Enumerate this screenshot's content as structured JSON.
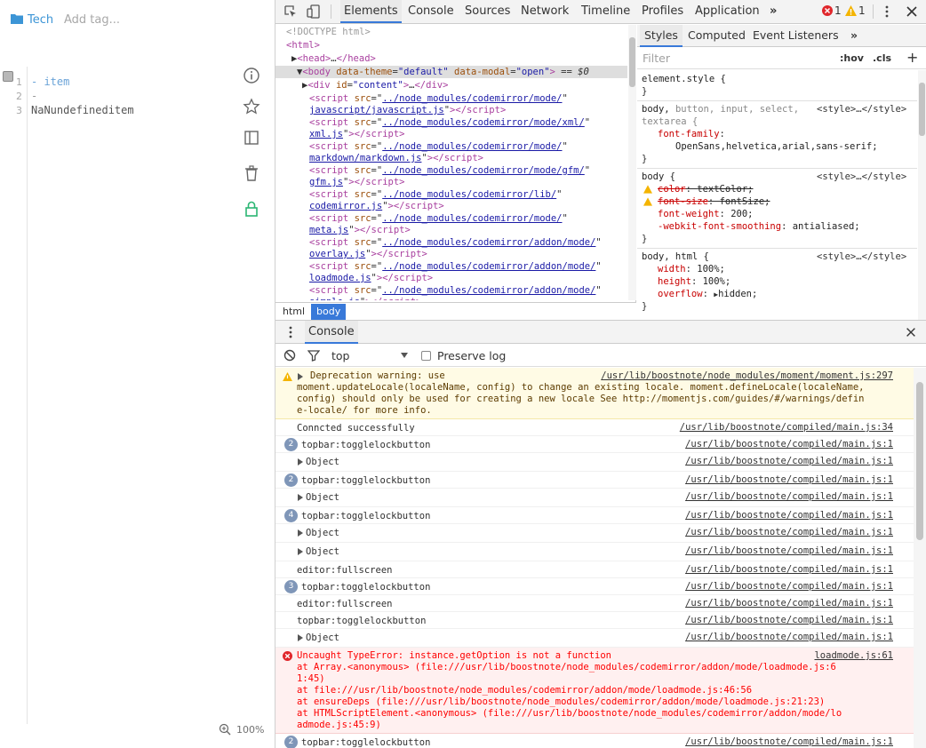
{
  "app": {
    "folder_tag": "Tech",
    "add_tag_placeholder": "Add tag...",
    "editor_lines": [
      "- item",
      "-",
      "NaNundefineditem"
    ],
    "line_numbers": [
      "1",
      "2",
      "3"
    ],
    "zoom": "100%",
    "icons": [
      "info-icon",
      "star-icon",
      "sidebar-icon",
      "trash-icon",
      "lock-icon"
    ]
  },
  "devtools": {
    "tabs": [
      "Elements",
      "Console",
      "Sources",
      "Network",
      "Timeline",
      "Profiles",
      "Application"
    ],
    "error_count": "1",
    "warning_count": "1",
    "dom_lines": [
      {
        "html": "<span class='cm'>&lt;!DOCTYPE html&gt;</span>"
      },
      {
        "html": "<span class='t'>&lt;html&gt;</span>"
      },
      {
        "html": "▶<span class='t'>&lt;head&gt;</span>…<span class='t'>&lt;/head&gt;</span>"
      },
      {
        "html": "▼<span class='t'>&lt;body </span><span class='an'>data-theme</span>=<span class='av'>\"default\"</span> <span class='an'>data-modal</span>=<span class='av'>\"open\"</span><span class='t'>&gt;</span> == <i>$0</i>"
      },
      {
        "html": "▶<span class='t'>&lt;div </span><span class='an'>id</span>=<span class='av'>\"content\"</span><span class='t'>&gt;</span>…<span class='t'>&lt;/div&gt;</span>"
      }
    ],
    "scripts": [
      [
        "../node_modules/codemirror/mode/",
        "javascript/javascript.js"
      ],
      [
        "../node_modules/codemirror/mode/xml/",
        "xml.js"
      ],
      [
        "../node_modules/codemirror/mode/",
        "markdown/markdown.js"
      ],
      [
        "../node_modules/codemirror/mode/gfm/",
        "gfm.js"
      ],
      [
        "../node_modules/codemirror/lib/",
        "codemirror.js"
      ],
      [
        "../node_modules/codemirror/mode/",
        "meta.js"
      ],
      [
        "../node_modules/codemirror/addon/mode/",
        "overlay.js"
      ],
      [
        "../node_modules/codemirror/addon/mode/",
        "loadmode.js"
      ],
      [
        "../node_modules/codemirror/addon/mode/",
        "simple.js"
      ]
    ],
    "breadcrumbs": [
      "html",
      "body"
    ],
    "styles_tabs": [
      "Styles",
      "Computed",
      "Event Listeners"
    ],
    "filter_placeholder": "Filter",
    "hov": ":hov",
    "cls": ".cls",
    "style_rules": [
      {
        "selector": "element.style {",
        "source": "",
        "props": [],
        "close": "}"
      },
      {
        "selector": "body, button, input, select,",
        "selector2": "textarea {",
        "source": "<style>…</style>",
        "props": [
          {
            "name": "font-family",
            "value": "",
            "value2": "OpenSans,helvetica,arial,sans-serif;"
          }
        ],
        "close": "}"
      },
      {
        "selector": "body {",
        "source": "<style>…</style>",
        "props": [
          {
            "name": "color",
            "value": "textColor;",
            "struck": true,
            "warn": true
          },
          {
            "name": "font-size",
            "value": "fontSize;",
            "struck": true,
            "warn": true
          },
          {
            "name": "font-weight",
            "value": "200;"
          },
          {
            "name": "-webkit-font-smoothing",
            "value": "antialiased;"
          }
        ],
        "close": "}"
      },
      {
        "selector": "body, html {",
        "source": "<style>…</style>",
        "props": [
          {
            "name": "width",
            "value": "100%;"
          },
          {
            "name": "height",
            "value": "100%;"
          },
          {
            "name": "overflow",
            "value": "hidden;",
            "triangle": true
          }
        ],
        "close": "}"
      }
    ],
    "drawer_title": "Console",
    "context": "top",
    "preserve_log": "Preserve log",
    "console": [
      {
        "kind": "warn",
        "text_lines": [
          "Deprecation warning: use",
          "moment.updateLocale(localeName, config) to change an existing locale. moment.defineLocale(localeName,",
          "config) should only be used for creating a new locale See http://momentjs.com/guides/#/warnings/defin",
          "e-locale/ for more info."
        ],
        "src": "/usr/lib/boostnote/node_modules/moment/moment.js:297"
      },
      {
        "kind": "log",
        "text": "Conncted successfully",
        "src": "/usr/lib/boostnote/compiled/main.js:34"
      },
      {
        "kind": "log",
        "badge": "2",
        "text": "topbar:togglelockbutton",
        "src": "/usr/lib/boostnote/compiled/main.js:1"
      },
      {
        "kind": "obj",
        "text": "Object",
        "src": "/usr/lib/boostnote/compiled/main.js:1"
      },
      {
        "kind": "log",
        "badge": "2",
        "text": "topbar:togglelockbutton",
        "src": "/usr/lib/boostnote/compiled/main.js:1"
      },
      {
        "kind": "obj",
        "text": "Object",
        "src": "/usr/lib/boostnote/compiled/main.js:1"
      },
      {
        "kind": "log",
        "badge": "4",
        "text": "topbar:togglelockbutton",
        "src": "/usr/lib/boostnote/compiled/main.js:1"
      },
      {
        "kind": "obj",
        "text": "Object",
        "src": "/usr/lib/boostnote/compiled/main.js:1"
      },
      {
        "kind": "obj",
        "text": "Object",
        "src": "/usr/lib/boostnote/compiled/main.js:1"
      },
      {
        "kind": "log",
        "text": "editor:fullscreen",
        "src": "/usr/lib/boostnote/compiled/main.js:1"
      },
      {
        "kind": "log",
        "badge": "3",
        "text": "topbar:togglelockbutton",
        "src": "/usr/lib/boostnote/compiled/main.js:1"
      },
      {
        "kind": "log",
        "text": "editor:fullscreen",
        "src": "/usr/lib/boostnote/compiled/main.js:1"
      },
      {
        "kind": "log",
        "text": "topbar:togglelockbutton",
        "src": "/usr/lib/boostnote/compiled/main.js:1"
      },
      {
        "kind": "obj",
        "text": "Object",
        "src": "/usr/lib/boostnote/compiled/main.js:1"
      },
      {
        "kind": "error",
        "text_lines": [
          "Uncaught TypeError: instance.getOption is not a function",
          "    at Array.<anonymous> (file:///usr/lib/boostnote/node_modules/codemirror/addon/mode/loadmode.js:6",
          "1:45)",
          "    at file:///usr/lib/boostnote/node_modules/codemirror/addon/mode/loadmode.js:46:56",
          "    at ensureDeps (file:///usr/lib/boostnote/node_modules/codemirror/addon/mode/loadmode.js:21:23)",
          "    at HTMLScriptElement.<anonymous> (file:///usr/lib/boostnote/node_modules/codemirror/addon/mode/lo",
          "admode.js:45:9)"
        ],
        "src": "loadmode.js:61"
      },
      {
        "kind": "log",
        "badge": "2",
        "text": "topbar:togglelockbutton",
        "src": "/usr/lib/boostnote/compiled/main.js:1"
      }
    ]
  },
  "colors": {
    "accent": "#3879d9",
    "tag": "#3c95d6",
    "lock": "#2bb673",
    "error": "#fe0000",
    "warn_bg": "#fffbe5"
  }
}
